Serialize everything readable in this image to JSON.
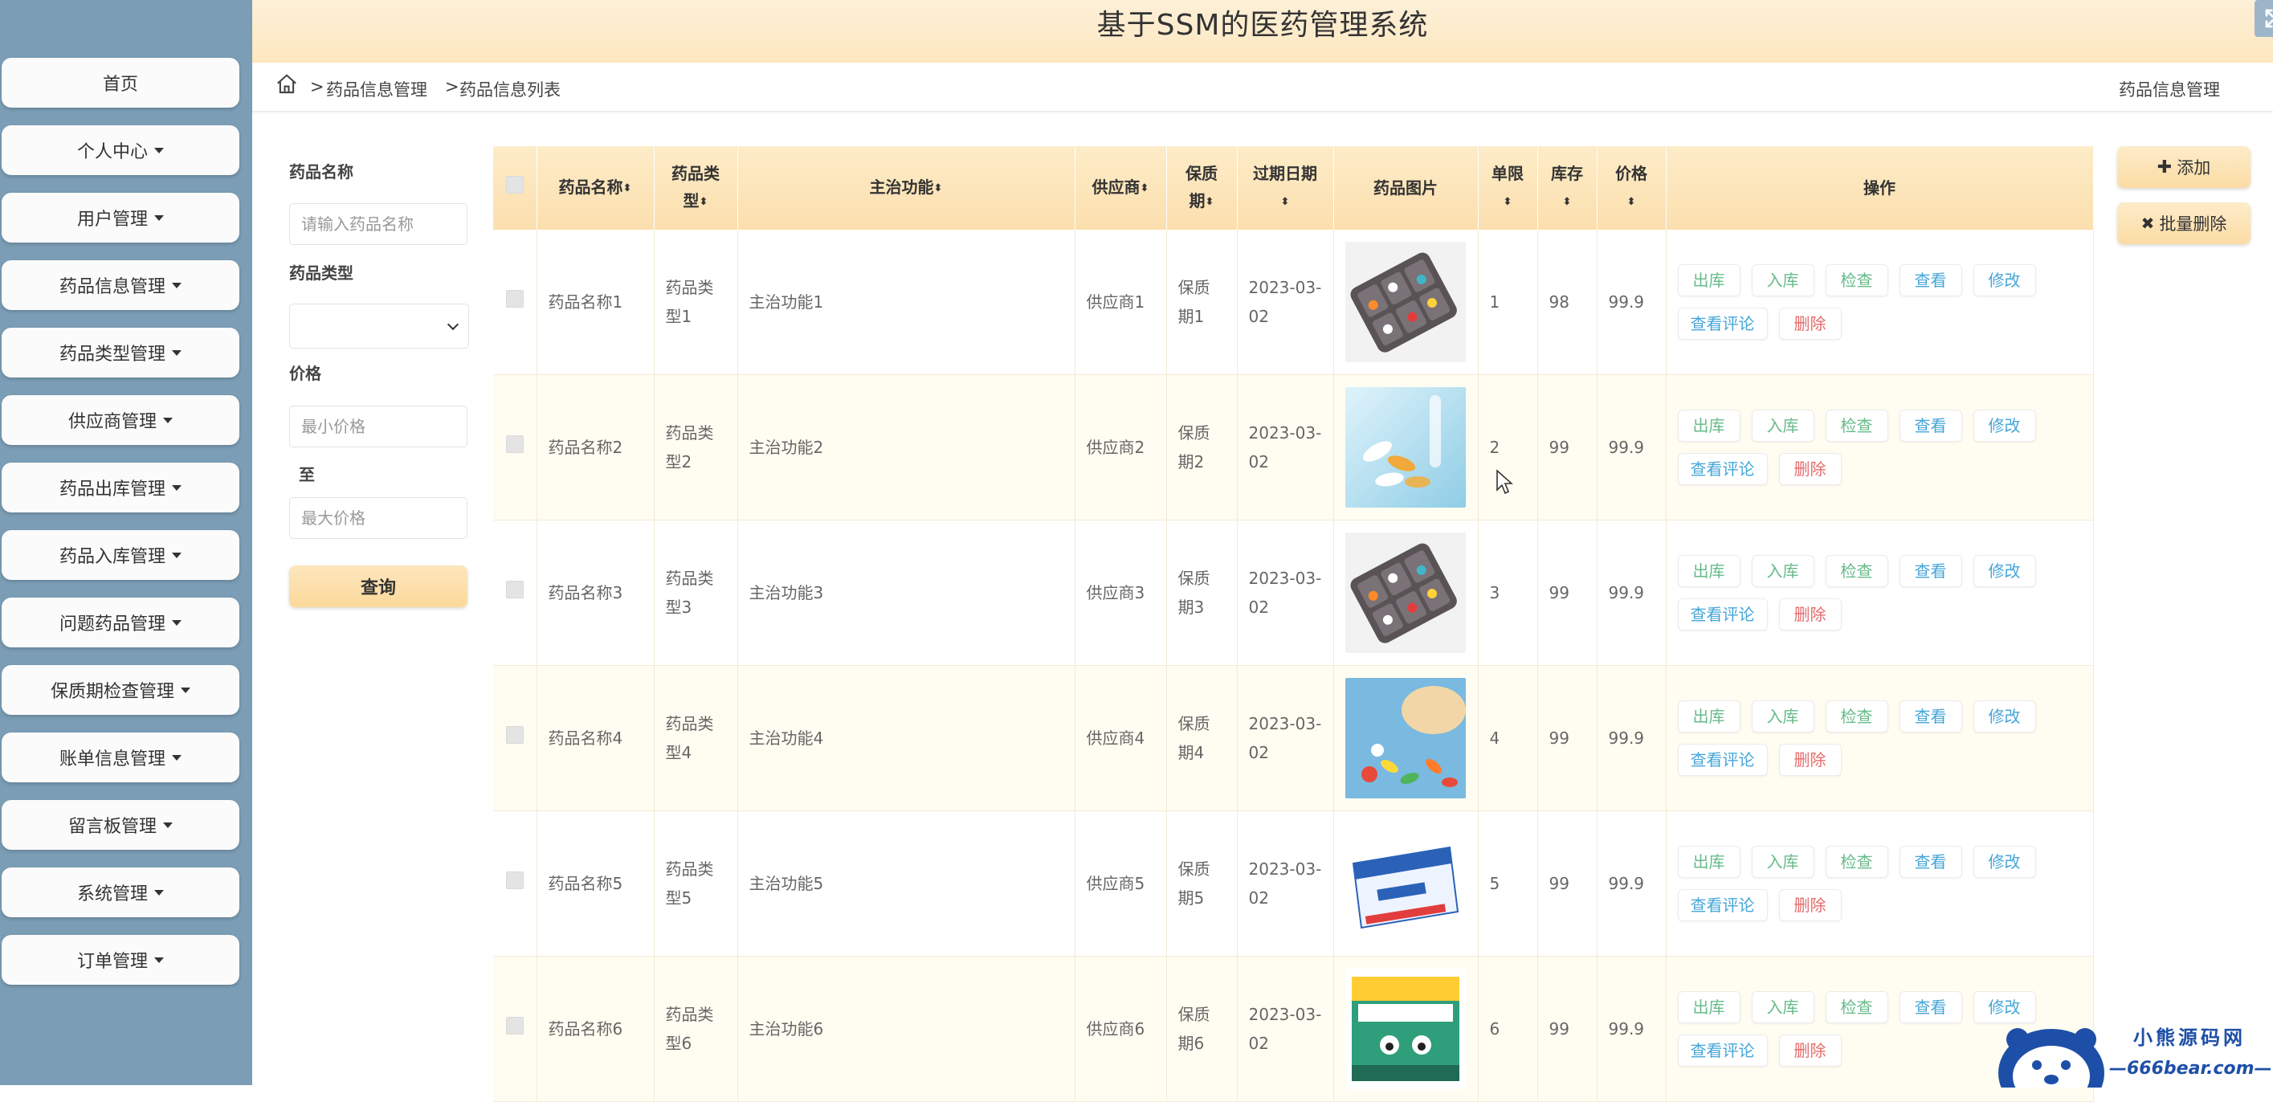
{
  "app": {
    "title": "基于SSM的医药管理系统"
  },
  "sidebar": {
    "items": [
      {
        "label": "首页",
        "caret": false
      },
      {
        "label": "个人中心",
        "caret": true
      },
      {
        "label": "用户管理",
        "caret": true
      },
      {
        "label": "药品信息管理",
        "caret": true
      },
      {
        "label": "药品类型管理",
        "caret": true
      },
      {
        "label": "供应商管理",
        "caret": true
      },
      {
        "label": "药品出库管理",
        "caret": true
      },
      {
        "label": "药品入库管理",
        "caret": true
      },
      {
        "label": "问题药品管理",
        "caret": true
      },
      {
        "label": "保质期检查管理",
        "caret": true
      },
      {
        "label": "账单信息管理",
        "caret": true
      },
      {
        "label": "留言板管理",
        "caret": true
      },
      {
        "label": "系统管理",
        "caret": true
      },
      {
        "label": "订单管理",
        "caret": true
      }
    ]
  },
  "breadcrumb": {
    "sep": ">",
    "level1": "药品信息管理",
    "level2": "药品信息列表",
    "right": "药品信息管理"
  },
  "search": {
    "name_label": "药品名称",
    "name_placeholder": "请输入药品名称",
    "type_label": "药品类型",
    "price_label": "价格",
    "min_placeholder": "最小价格",
    "to_label": "至",
    "max_placeholder": "最大价格",
    "query_label": "查询"
  },
  "actions": {
    "add_label": "添加",
    "batch_delete_label": "批量删除"
  },
  "table": {
    "headers": {
      "name": "药品名称",
      "type_line1": "药品类",
      "type_line2": "型",
      "func": "主治功能",
      "supplier": "供应商",
      "shelf_line1": "保质",
      "shelf_line2": "期",
      "expire": "过期日期",
      "image": "药品图片",
      "limit": "单限",
      "stock": "库存",
      "price": "价格",
      "ops": "操作"
    },
    "ops": {
      "out": "出库",
      "in": "入库",
      "check": "检查",
      "view": "查看",
      "edit": "修改",
      "comments": "查看评论",
      "delete": "删除"
    },
    "rows": [
      {
        "name": "药品名称1",
        "type1": "药品类",
        "type2": "型1",
        "func": "主治功能1",
        "supplier": "供应商1",
        "shelf1": "保质",
        "shelf2": "期1",
        "date1": "2023-03-",
        "date2": "02",
        "limit": "1",
        "stock": "98",
        "price": "99.9",
        "image": "pill-organizer"
      },
      {
        "name": "药品名称2",
        "type1": "药品类",
        "type2": "型2",
        "func": "主治功能2",
        "supplier": "供应商2",
        "shelf1": "保质",
        "shelf2": "期2",
        "date1": "2023-03-",
        "date2": "02",
        "limit": "2",
        "stock": "99",
        "price": "99.9",
        "image": "capsules-lab"
      },
      {
        "name": "药品名称3",
        "type1": "药品类",
        "type2": "型3",
        "func": "主治功能3",
        "supplier": "供应商3",
        "shelf1": "保质",
        "shelf2": "期3",
        "date1": "2023-03-",
        "date2": "02",
        "limit": "3",
        "stock": "99",
        "price": "99.9",
        "image": "pill-organizer"
      },
      {
        "name": "药品名称4",
        "type1": "药品类",
        "type2": "型4",
        "func": "主治功能4",
        "supplier": "供应商4",
        "shelf1": "保质",
        "shelf2": "期4",
        "date1": "2023-03-",
        "date2": "02",
        "limit": "4",
        "stock": "99",
        "price": "99.9",
        "image": "colorful-pills"
      },
      {
        "name": "药品名称5",
        "type1": "药品类",
        "type2": "型5",
        "func": "主治功能5",
        "supplier": "供应商5",
        "shelf1": "保质",
        "shelf2": "期5",
        "date1": "2023-03-",
        "date2": "02",
        "limit": "5",
        "stock": "99",
        "price": "99.9",
        "image": "medicine-box-blue"
      },
      {
        "name": "药品名称6",
        "type1": "药品类",
        "type2": "型6",
        "func": "主治功能6",
        "supplier": "供应商6",
        "shelf1": "保质",
        "shelf2": "期6",
        "date1": "2023-03-",
        "date2": "02",
        "limit": "6",
        "stock": "99",
        "price": "99.9",
        "image": "capsule-box-green"
      }
    ]
  },
  "watermark": {
    "cn": "小熊源码网",
    "url": "—666bear.com—"
  },
  "colors": {
    "sidebar_bg": "#7b9db5",
    "header_bg": "#fde9c4",
    "accent_green": "#67bb8a",
    "accent_blue": "#45a6d8",
    "accent_red": "#e56b6b"
  },
  "icons": {
    "home": "home-icon",
    "fullscreen": "fullscreen-icon",
    "user": "user-icon",
    "add": "plus-icon",
    "batch_delete": "close-icon"
  }
}
